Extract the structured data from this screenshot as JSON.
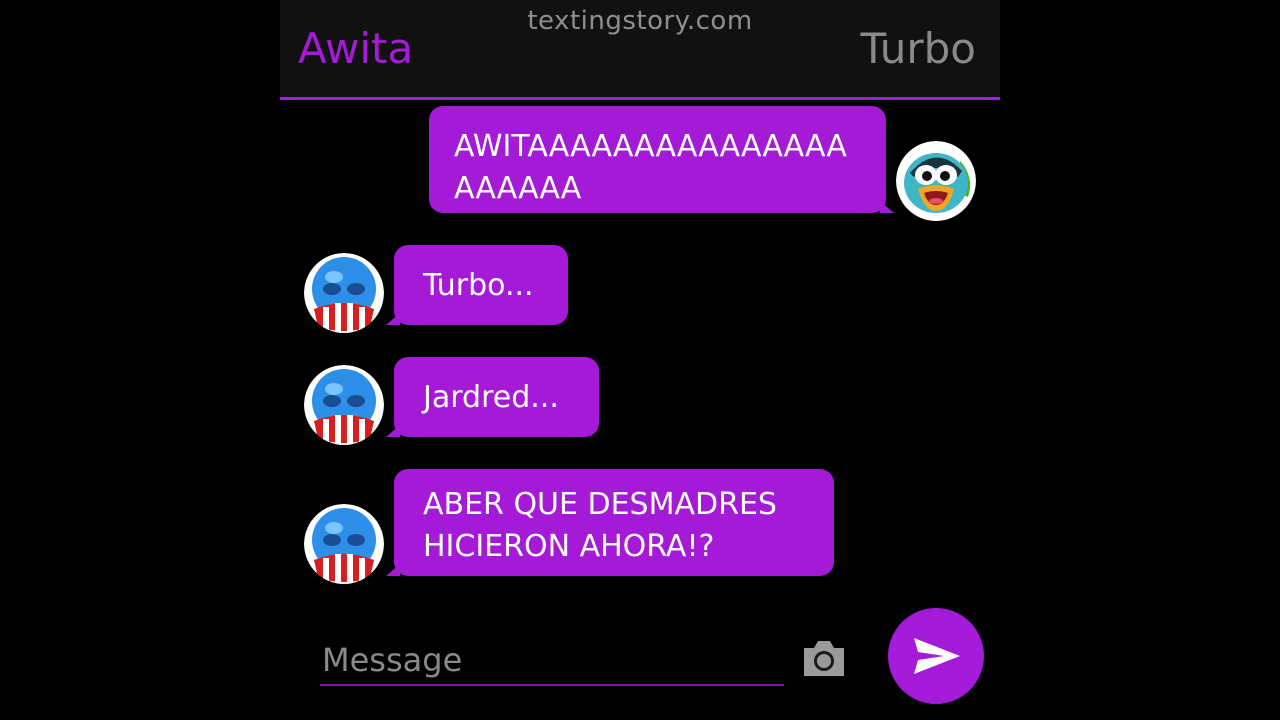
{
  "header": {
    "watermark": "textingstory.com",
    "contact_left": "Awita",
    "contact_right": "Turbo"
  },
  "messages": [
    {
      "sender": "Turbo",
      "direction": "outgoing",
      "lines": [
        "AWITAAAAAAAAAAAAAAA",
        "AAAAAA"
      ],
      "avatar": "penguin-avatar"
    },
    {
      "sender": "Awita",
      "direction": "incoming",
      "lines": [
        "Turbo..."
      ],
      "avatar": "blue-creature-avatar"
    },
    {
      "sender": "Awita",
      "direction": "incoming",
      "lines": [
        "Jardred..."
      ],
      "avatar": "blue-creature-avatar"
    },
    {
      "sender": "Awita",
      "direction": "incoming",
      "lines": [
        "ABER QUE DESMADRES",
        "HICIERON AHORA!?"
      ],
      "avatar": "blue-creature-avatar"
    }
  ],
  "composer": {
    "placeholder": "Message",
    "camera_icon": "camera-icon",
    "send_icon": "send-icon"
  },
  "colors": {
    "accent": "#a41ad6",
    "header_bg": "#111111",
    "background": "#000000",
    "muted_text": "#8a8a8a"
  }
}
